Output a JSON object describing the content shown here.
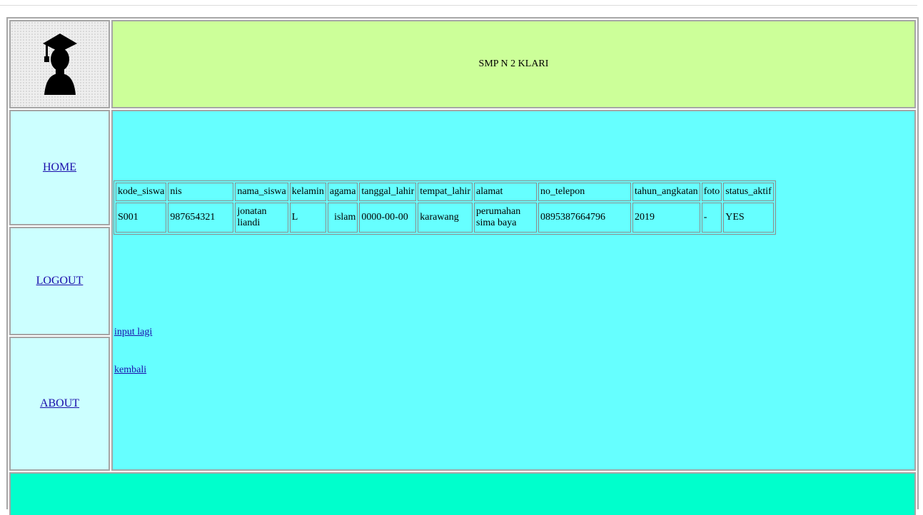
{
  "header": {
    "title": "SMP N 2 KLARI"
  },
  "logo": {
    "icon": "graduate-silhouette-icon"
  },
  "nav": {
    "home": "HOME",
    "logout": "LOGOUT",
    "about": "ABOUT"
  },
  "table": {
    "columns": [
      "kode_siswa",
      "nis",
      "nama_siswa",
      "kelamin",
      "agama",
      "tanggal_lahir",
      "tempat_lahir",
      "alamat",
      "no_telepon",
      "tahun_angkatan",
      "foto",
      "status_aktif"
    ],
    "rows": [
      [
        "S001",
        "987654321",
        "jonatan liandi",
        "L",
        "islam",
        "0000-00-00",
        "karawang",
        "perumahan sima baya",
        "0895387664796",
        "2019",
        "-",
        "YES"
      ]
    ]
  },
  "links": {
    "input_again": "input lagi",
    "back": "kembali"
  },
  "colors": {
    "header_bg": "#ccff99",
    "nav_bg": "#ccffff",
    "content_bg": "#66ffff",
    "footer_bg": "#00ffcc"
  }
}
